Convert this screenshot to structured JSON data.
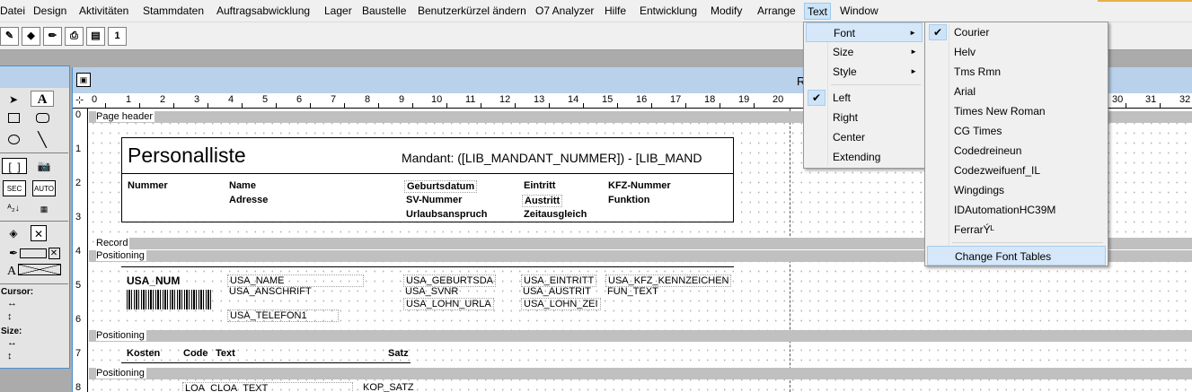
{
  "menubar": {
    "items": [
      "Datei",
      "Design",
      "Aktivitäten",
      "Stammdaten",
      "Auftragsabwicklung",
      "Lager",
      "Baustelle",
      "Benutzerkürzel ändern",
      "O7 Analyzer",
      "Hilfe",
      "Entwicklung",
      "Modify",
      "Arrange",
      "Text",
      "Window"
    ]
  },
  "toolbar": {
    "buttons": [
      "edit-icon",
      "shapes-icon",
      "pencil-icon",
      "print-icon",
      "layout-icon",
      "one-icon"
    ],
    "one_label": "1"
  },
  "palette": {
    "tools": {
      "arrow": "➤",
      "text": "A",
      "sec": "SEC",
      "auto": "AUTO",
      "sort": "ᴬ₂↓",
      "field_btn": "A"
    },
    "cursor_label": "Cursor:",
    "size_label": "Size:",
    "h_arrow": "↔",
    "v_arrow": "↕"
  },
  "report_window": {
    "title": "R",
    "ruler_numbers": [
      "0",
      "1",
      "2",
      "3",
      "4",
      "5",
      "6",
      "7",
      "8",
      "9",
      "10",
      "11",
      "12",
      "13",
      "14",
      "15",
      "16",
      "17",
      "18",
      "19",
      "20",
      "30",
      "31",
      "32"
    ],
    "vruler_numbers": [
      "0",
      "1",
      "2",
      "3",
      "4",
      "5",
      "6",
      "7",
      "8"
    ]
  },
  "report": {
    "page_header": "Page header",
    "record": "Record",
    "positioning": "Positioning",
    "title": "Personalliste",
    "mandant": "Mandant: ([LIB_MANDANT_NUMMER]) - [LIB_MAND",
    "header_labels": {
      "nummer": "Nummer",
      "name": "Name",
      "adresse": "Adresse",
      "geburtsdatum": "Geburtsdatum",
      "sv_nummer": "SV-Nummer",
      "urlaubsanspruch": "Urlaubsanspruch",
      "eintritt": "Eintritt",
      "austritt": "Austritt",
      "zeitausgleich": "Zeitausgleich",
      "kfz": "KFZ-Nummer",
      "funktion": "Funktion"
    },
    "record_fields": {
      "usa_num": "USA_NUM",
      "usa_name": "USA_NAME",
      "usa_anschrift": "USA_ANSCHRIFT",
      "usa_telefon": "USA_TELEFON1",
      "usa_geburtsda": "USA_GEBURTSDA",
      "usa_svnr": "USA_SVNR",
      "usa_lohn_urla": "USA_LOHN_URLA",
      "usa_eintritt": "USA_EINTRITT",
      "usa_austrit": "USA_AUSTRIT",
      "usa_lohn_zei": "USA_LOHN_ZEI",
      "usa_kfz": "USA_KFZ_KENNZEICHEN",
      "fun_text": "FUN_TEXT"
    },
    "cost_labels": {
      "kosten": "Kosten",
      "code": "Code",
      "text": "Text",
      "satz": "Satz"
    },
    "cost_fields": {
      "loa_cloa_text": "LOA_CLOA_TEXT",
      "kop_satz": "KOP_SATZ"
    }
  },
  "text_menu": {
    "items": [
      {
        "label": "Font",
        "submenu": true
      },
      {
        "label": "Size",
        "submenu": true
      },
      {
        "label": "Style",
        "submenu": true
      },
      {
        "label": "Left",
        "checked": true
      },
      {
        "label": "Right"
      },
      {
        "label": "Center"
      },
      {
        "label": "Extending"
      }
    ],
    "arrow": "►",
    "check": "✔"
  },
  "font_menu": {
    "items": [
      "Courier",
      "Helv",
      "Tms Rmn",
      "Arial",
      "Times New Roman",
      "CG Times",
      "Codedreineun",
      "Codezweifuenf_IL",
      "Wingdings",
      "IDAutomationHC39M",
      "FerrarÝᴸ",
      "Change Font Tables"
    ],
    "checked": "Courier"
  },
  "colors": {
    "menu_highlight": "#d5e7f8",
    "titlebar": "#b9d1ea",
    "accent_line": "#e8b04c"
  }
}
